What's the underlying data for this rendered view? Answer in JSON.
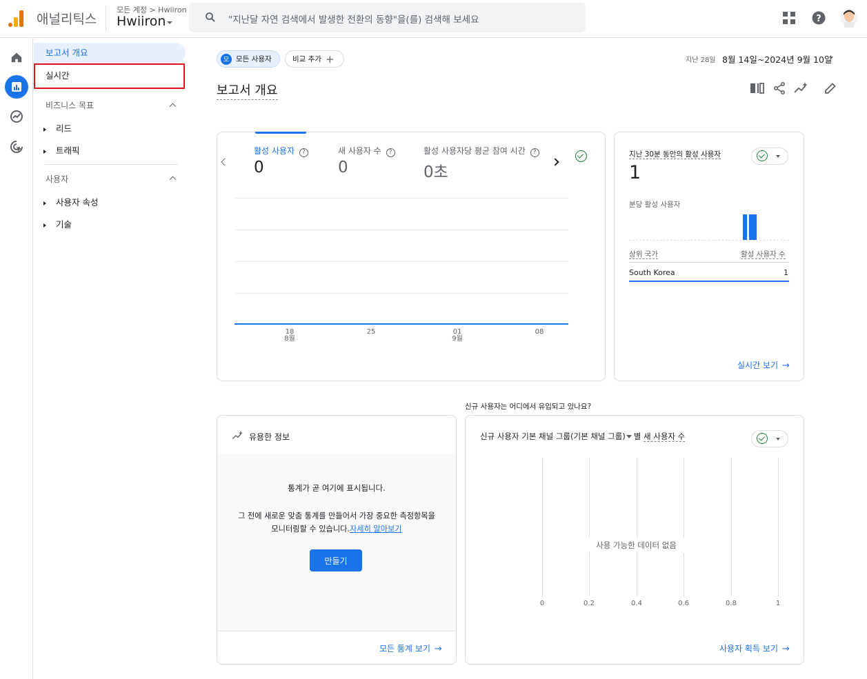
{
  "header": {
    "app_name": "애널리틱스",
    "account_path": "모든 계정 > Hwiiron",
    "account_name": "Hwiiron",
    "search_placeholder": "\"지난달 자연 검색에서 발생한 전환의 동향\"을(를) 검색해 보세요"
  },
  "sidebar": {
    "overview": "보고서 개요",
    "realtime": "실시간",
    "section_business": "비즈니스 목표",
    "lead": "리드",
    "traffic": "트래픽",
    "section_user": "사용자",
    "user_attributes": "사용자 속성",
    "tech": "기술"
  },
  "toolbar": {
    "chip_badge": "모",
    "chip_all_users": "모든 사용자",
    "chip_add_compare": "비교 추가",
    "date_prefix": "지난 28일",
    "date_range": "8월 14일~2024년 9월 10일"
  },
  "page_title": "보고서 개요",
  "main_card": {
    "metric1_label": "활성 사용자",
    "metric1_value": "0",
    "metric2_label": "새 사용자 수",
    "metric2_value": "0",
    "metric3_label": "활성 사용자당 평균 참여 시간",
    "metric3_value": "0초",
    "x_ticks": [
      {
        "top": "18",
        "bottom": "8월"
      },
      {
        "top": "25",
        "bottom": ""
      },
      {
        "top": "01",
        "bottom": "9월"
      },
      {
        "top": "08",
        "bottom": ""
      }
    ]
  },
  "realtime_card": {
    "title": "지난 30분 동안의 활성 사용자",
    "value": "1",
    "per_minute_label": "분당 활성 사용자",
    "col_country": "상위 국가",
    "col_users": "활성 사용자 수",
    "row_country": "South Korea",
    "row_value": "1",
    "link": "실시간 보기",
    "per_minute_bars": [
      1,
      1
    ]
  },
  "acquisition_question": "신규 사용자는 어디에서 유입되고 있나요?",
  "insights_card": {
    "title": "유용한 정보",
    "heading": "통계가 곧 여기에 표시됩니다.",
    "body_line1": "그 전에 새로운 맞춤 통계를 만들어서 가장 중요한 측정항목을",
    "body_line2": "모니터링할 수 있습니다.",
    "learn_more": "자세히 알아보기",
    "create_button": "만들기",
    "link": "모든 통계 보기"
  },
  "acquisition_card": {
    "title_prefix": "신규 사용자 기본 채널 그룹(기본 채널 그룹)",
    "title_mid": "별",
    "title_metric": "새 사용자 수",
    "no_data": "사용 가능한 데이터 없음",
    "axis_ticks": [
      "0",
      "0.2",
      "0.4",
      "0.6",
      "0.8",
      "1"
    ],
    "link": "사용자 획득 보기"
  },
  "colors": {
    "accent": "#1a73e8",
    "highlight_border": "#e0101a",
    "check_green": "#188038"
  }
}
